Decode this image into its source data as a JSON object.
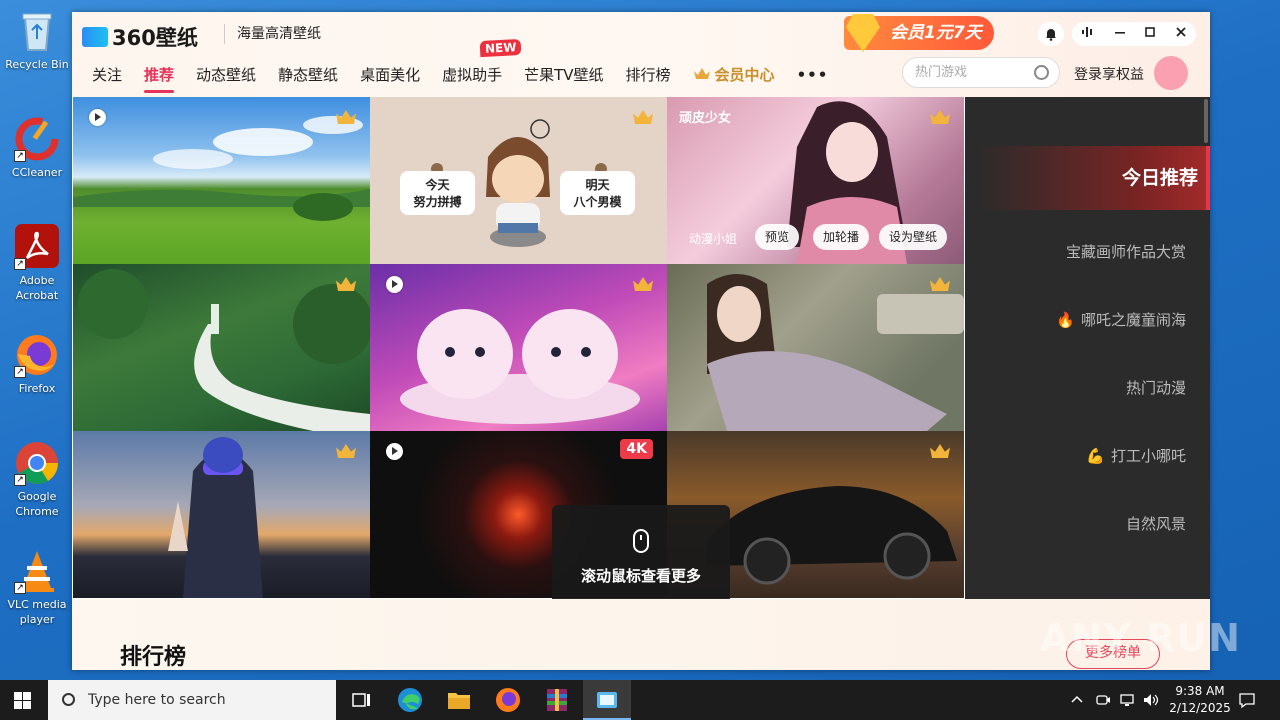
{
  "desktop": {
    "icons": [
      {
        "label": "Recycle Bin",
        "icon": "recycle-bin-icon"
      },
      {
        "label": "CCleaner",
        "icon": "ccleaner-icon"
      },
      {
        "label": "Adobe Acrobat",
        "icon": "adobe-acrobat-icon"
      },
      {
        "label": "Firefox",
        "icon": "firefox-icon"
      },
      {
        "label": "Google Chrome",
        "icon": "chrome-icon"
      },
      {
        "label": "VLC media player",
        "icon": "vlc-icon"
      }
    ],
    "watermark": "ANY RUN"
  },
  "app": {
    "logo_text": "360壁纸",
    "tagline": "海量高清壁纸",
    "promo": "会员1元7天",
    "nav": [
      "关注",
      "推荐",
      "动态壁纸",
      "静态壁纸",
      "桌面美化",
      "虚拟助手",
      "芒果TV壁纸",
      "排行榜",
      "会员中心"
    ],
    "nav_more": "•••",
    "new_badge": "NEW",
    "search_placeholder": "热门游戏",
    "login": "登录享权益",
    "tiles": [
      {
        "id": "meadow",
        "play": true,
        "crown": true
      },
      {
        "id": "cartoon",
        "play": false,
        "crown": true,
        "left_text": [
          "今天",
          "努力拼搏"
        ],
        "right_text": [
          "明天",
          "八个男模"
        ]
      },
      {
        "id": "anime-girl",
        "play": false,
        "crown": true,
        "title": "顽皮少女",
        "category": "动漫小姐",
        "actions": [
          "预览",
          "加轮播",
          "设为壁纸"
        ]
      },
      {
        "id": "forest-stream",
        "play": false,
        "crown": true
      },
      {
        "id": "pink-puppies",
        "play": true,
        "crown": true
      },
      {
        "id": "portrait",
        "play": false,
        "crown": true
      },
      {
        "id": "cyber-girl",
        "play": false,
        "crown": true
      },
      {
        "id": "red-vortex",
        "play": true,
        "badge": "4K"
      },
      {
        "id": "black-car",
        "play": false,
        "crown": true
      }
    ],
    "side_menu": {
      "active": "今日推荐",
      "items": [
        "宝藏画师作品大赏",
        "哪吒之魔童闹海",
        "热门动漫",
        "打工小哪吒",
        "自然风景"
      ]
    },
    "scroll_hint": "滚动鼠标查看更多",
    "ranking_title": "排行榜",
    "ranking_more": "更多榜单"
  },
  "taskbar": {
    "search_placeholder": "Type here to search",
    "time": "9:38 AM",
    "date": "2/12/2025"
  },
  "colors": {
    "accent": "#e8335a",
    "vip_gold": "#c8902a",
    "side_bg": "#2b2b2b"
  }
}
